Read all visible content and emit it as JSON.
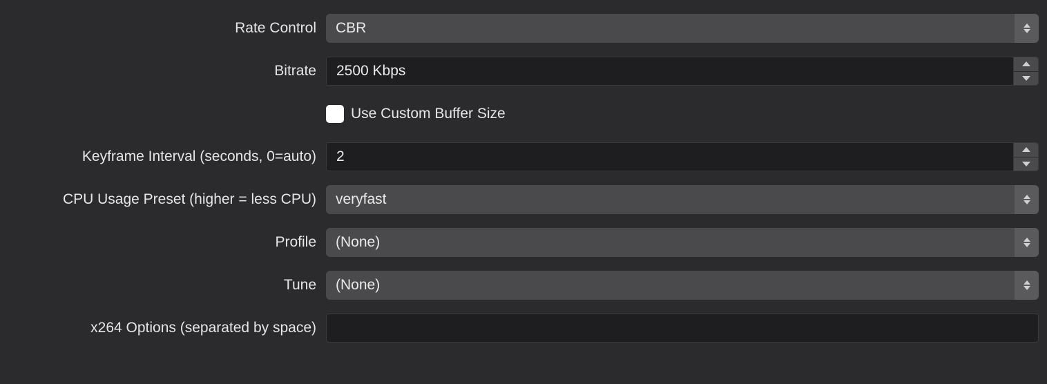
{
  "labels": {
    "rateControl": "Rate Control",
    "bitrate": "Bitrate",
    "keyframeInterval": "Keyframe Interval (seconds, 0=auto)",
    "cpuPreset": "CPU Usage Preset (higher = less CPU)",
    "profile": "Profile",
    "tune": "Tune",
    "x264Options": "x264 Options (separated by space)"
  },
  "values": {
    "rateControl": "CBR",
    "bitrate": "2500 Kbps",
    "keyframeInterval": "2",
    "cpuPreset": "veryfast",
    "profile": "(None)",
    "tune": "(None)",
    "x264Options": ""
  },
  "checkbox": {
    "useCustomBufferLabel": "Use Custom Buffer Size",
    "useCustomBufferChecked": false
  }
}
